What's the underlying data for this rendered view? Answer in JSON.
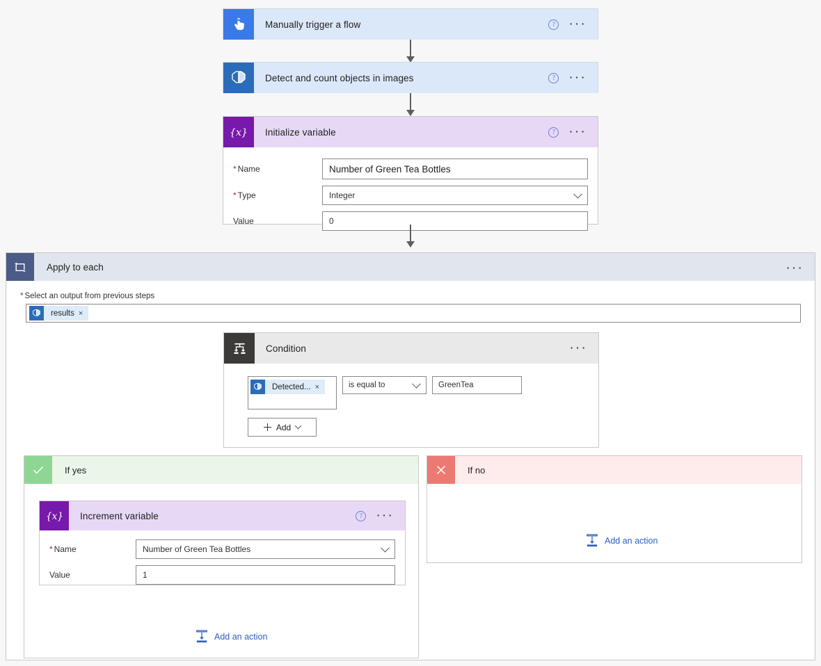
{
  "colors": {
    "canvas_bg": "#f7f7f7",
    "trigger_header": "#dbe8fa",
    "trigger_icon": "#3a7ae8",
    "ai_icon": "#2b6cb9",
    "variable_header": "#e7d9f5",
    "variable_icon": "#7719aa",
    "loop_header": "#e1e5ed",
    "loop_icon": "#4a5b87",
    "condition_icon": "#3b3a39",
    "condition_header": "#e9e9e9",
    "yes_header": "#eaf6ea",
    "yes_icon": "#8fd694",
    "no_header": "#fdeceb",
    "no_icon": "#ec7a72",
    "link": "#2f5fbf",
    "required_asterisk": "#a4262c"
  },
  "trigger": {
    "title": "Manually trigger a flow",
    "icon": "touch-trigger-icon",
    "help_glyph": "?",
    "ellipsis_glyph": "···"
  },
  "detect_action": {
    "title": "Detect and count objects in images",
    "icon": "ai-builder-brain-icon",
    "help_glyph": "?",
    "ellipsis_glyph": "···"
  },
  "initialize_variable": {
    "title": "Initialize variable",
    "icon": "variable-braces-icon",
    "help_glyph": "?",
    "ellipsis_glyph": "···",
    "fields": [
      {
        "label": "Name",
        "required": true,
        "value": "Number of Green Tea Bottles",
        "control": "text"
      },
      {
        "label": "Type",
        "required": true,
        "value": "Integer",
        "control": "dropdown"
      },
      {
        "label": "Value",
        "required": false,
        "value": "0",
        "control": "text"
      }
    ]
  },
  "apply_to_each": {
    "title": "Apply to each",
    "icon": "loop-icon",
    "ellipsis_glyph": "···",
    "select_label": "Select an output from previous steps",
    "select_required": true,
    "token": {
      "text": "results",
      "icon": "ai-builder-brain-icon",
      "remove_glyph": "×"
    }
  },
  "condition": {
    "title": "Condition",
    "icon": "condition-branch-icon",
    "ellipsis_glyph": "···",
    "left_token": {
      "text": "Detected...",
      "icon": "ai-builder-brain-icon",
      "remove_glyph": "×"
    },
    "operator": "is equal to",
    "right_value": "GreenTea",
    "add_button": "Add"
  },
  "if_yes": {
    "title": "If yes",
    "icon": "checkmark-icon",
    "add_action_label": "Add an action",
    "add_action_icon": "add-action-icon"
  },
  "if_no": {
    "title": "If no",
    "icon": "cross-icon",
    "add_action_label": "Add an action",
    "add_action_icon": "add-action-icon"
  },
  "increment_variable": {
    "title": "Increment variable",
    "icon": "variable-braces-icon",
    "help_glyph": "?",
    "ellipsis_glyph": "···",
    "fields": [
      {
        "label": "Name",
        "required": true,
        "value": "Number of Green Tea Bottles",
        "control": "dropdown"
      },
      {
        "label": "Value",
        "required": false,
        "value": "1",
        "control": "text"
      }
    ]
  }
}
